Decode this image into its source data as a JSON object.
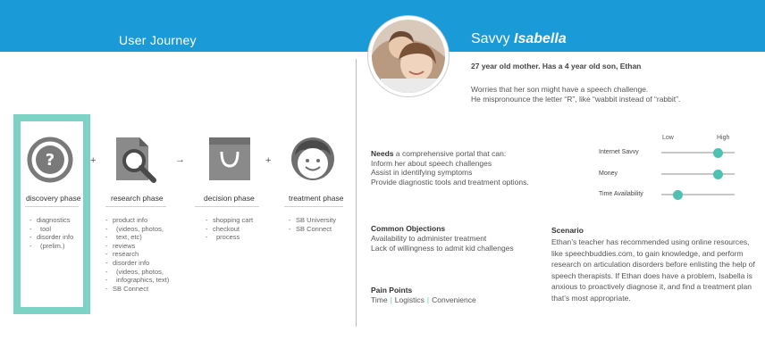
{
  "header": {
    "left_title": "User Journey",
    "persona_first": "Savvy ",
    "persona_name": "Isabella"
  },
  "journey": {
    "phases": [
      {
        "label": "discovery phase",
        "icon": "question-icon",
        "items": [
          "diagnostics",
          "tool",
          "disorder info",
          "(prelim.)"
        ]
      },
      {
        "label": "research phase",
        "icon": "document-search-icon",
        "items": [
          "product info",
          "(videos, photos,",
          "text, etc)",
          "reviews",
          "research",
          "disorder info",
          "(videos, photos,",
          "infographics, text)",
          "SB Connect"
        ]
      },
      {
        "label": "decision phase",
        "icon": "shopping-bag-icon",
        "items": [
          "shopping cart",
          "checkout",
          "process"
        ]
      },
      {
        "label": "treatment phase",
        "icon": "smiley-face-icon",
        "items": [
          "SB University",
          "SB Connect"
        ]
      }
    ],
    "operators": [
      "+",
      "→",
      "+"
    ],
    "highlight_color": "#7dd2c6"
  },
  "persona": {
    "subhead": "27 year old mother. Has a 4 year old son, Ethan",
    "desc_lines": [
      "Worries that her son might have a speech challenge.",
      "He mispronounce the letter “R”, like “wabbit instead of “rabbit”."
    ],
    "needs_title": "Needs",
    "needs_lead": " a comprehensive portal that can:",
    "needs_lines": [
      "Inform her about speech challenges",
      "Assist in identifying symptoms",
      "Provide diagnostic tools and treatment options."
    ],
    "scale": {
      "low": "Low",
      "high": "High"
    },
    "sliders": [
      {
        "label": "Internet Savvy",
        "level": 0.78
      },
      {
        "label": "Money",
        "level": 0.78
      },
      {
        "label": "Time Availability",
        "level": 0.22
      }
    ],
    "objections_title": "Common Objections",
    "objections_lines": [
      "Availability to administer treatment",
      "Lack of willingness to admit kid challenges"
    ],
    "pain_title": "Pain Points",
    "pain_items": [
      "Time",
      "Logistics",
      "Convenience"
    ],
    "scenario_title": "Scenario",
    "scenario_text": "Ethan’s teacher has recommended using online resources, like speechbuddies.com, to gain knowledge, and perform research on articulation disorders before enlisting the help of speech therapists. If Ethan does have a problem, Isabella is anxious to proactively diagnose it, and find a treatment plan that’s most appropriate.",
    "accent_color": "#4fc1b2"
  },
  "colors": {
    "header_bg": "#1a9ad6",
    "icon_gray": "#7a7a7a"
  }
}
